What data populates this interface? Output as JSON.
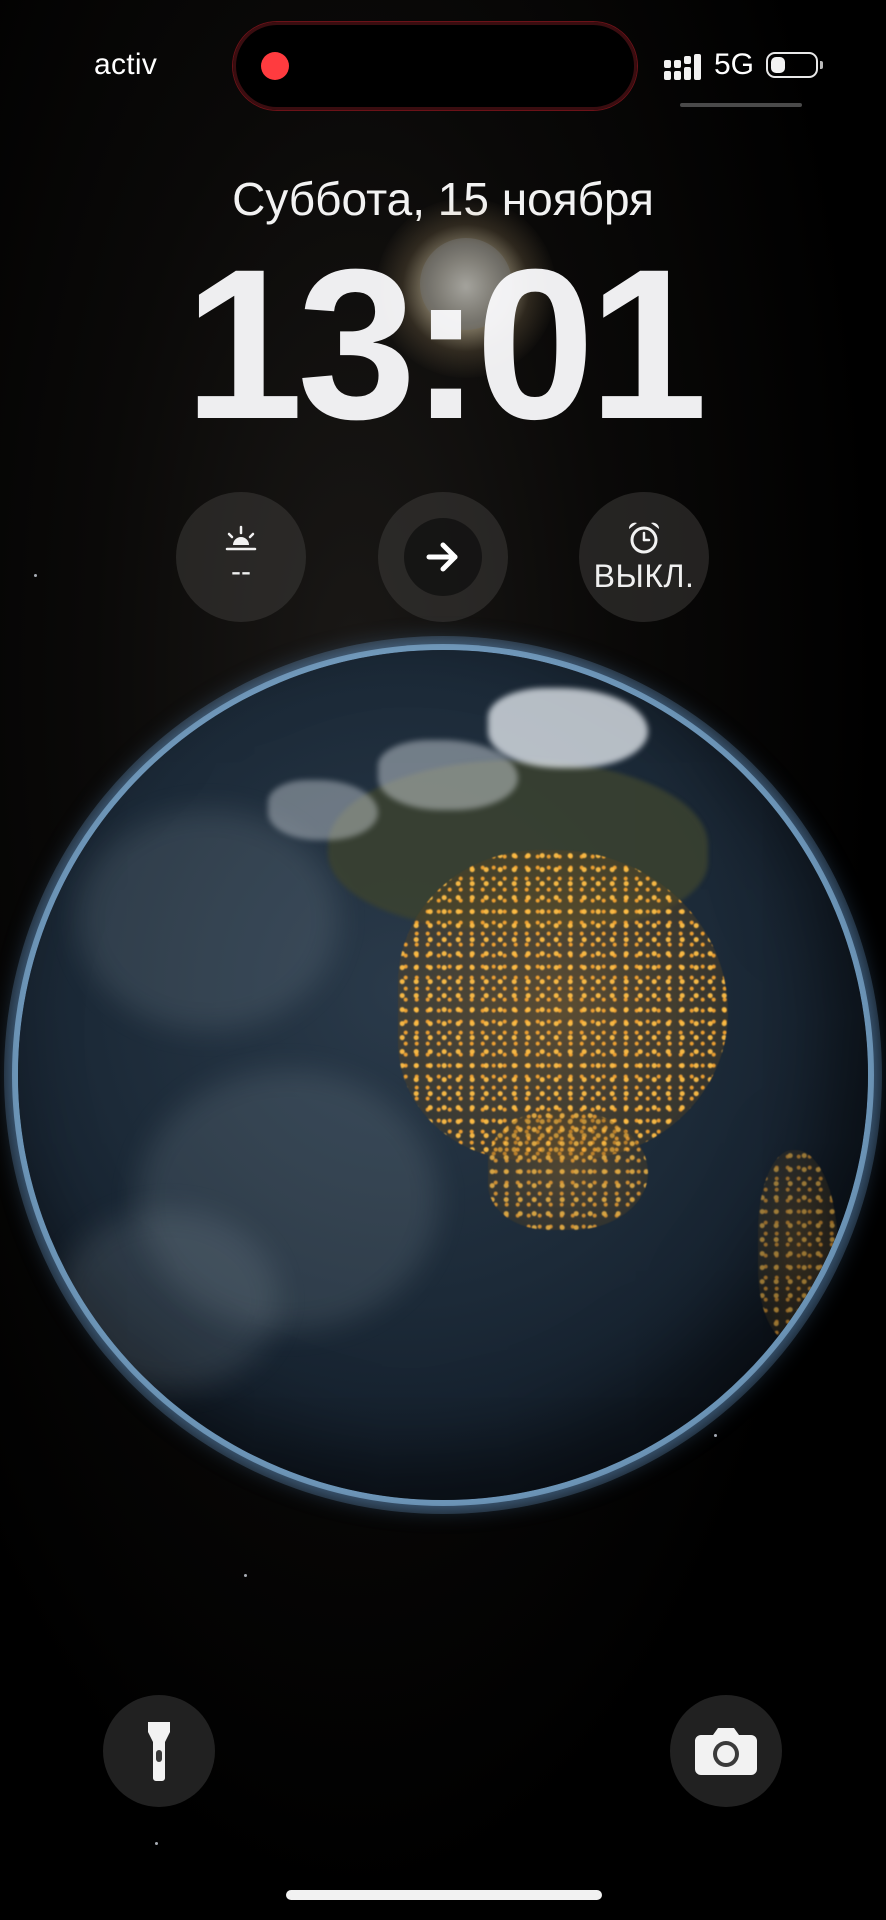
{
  "status_bar": {
    "carrier": "activ",
    "network": "5G",
    "recording_indicator": "red-dot",
    "battery_level": 0.35
  },
  "lock_screen": {
    "date": "Суббота, 15 ноября",
    "time": "13:01"
  },
  "widgets": [
    {
      "icon": "sunrise-icon",
      "value": "--"
    },
    {
      "icon": "arrow-right-icon",
      "value": ""
    },
    {
      "icon": "alarm-clock-icon",
      "value": "ВЫКЛ."
    }
  ],
  "bottom_buttons": {
    "left": "flashlight-icon",
    "right": "camera-icon"
  },
  "colors": {
    "recording": "#ff3b3f",
    "city_lights": "#ffb347",
    "atmosphere": "#8fc3ea"
  }
}
